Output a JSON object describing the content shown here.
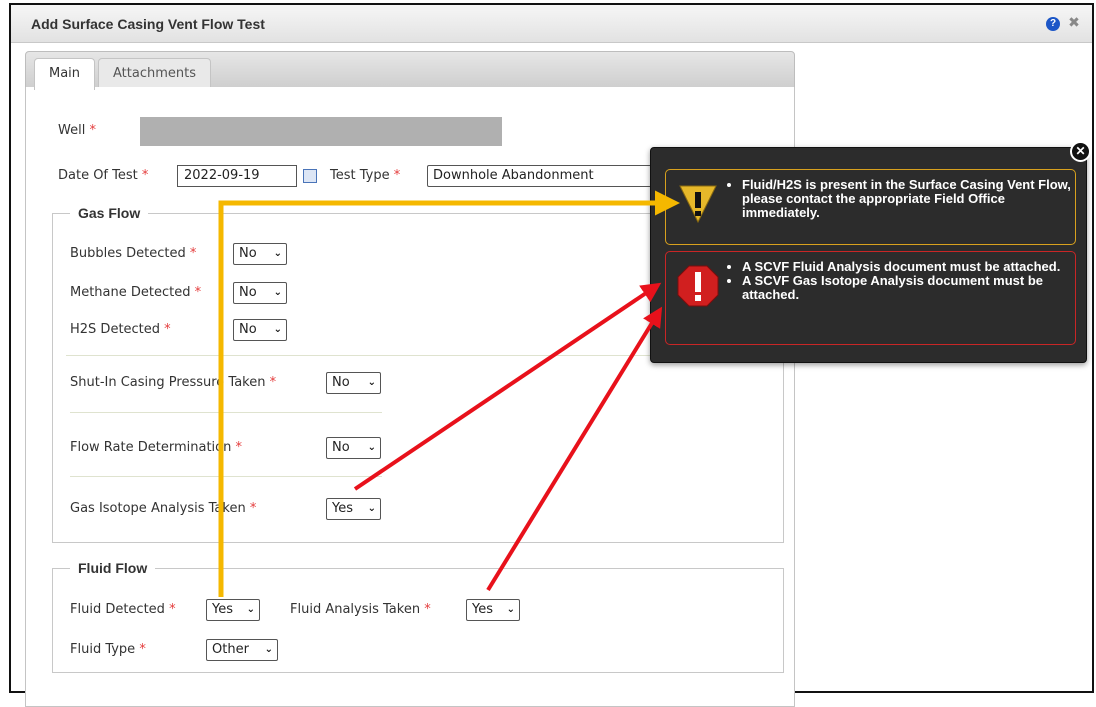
{
  "window": {
    "title": "Add Surface Casing Vent Flow Test",
    "help_icon": "question-circle-icon",
    "close_icon": "close-icon"
  },
  "tabs": [
    {
      "label": "Main",
      "active": true
    },
    {
      "label": "Attachments",
      "active": false
    }
  ],
  "form": {
    "well": {
      "label": "Well",
      "required_mark": "*"
    },
    "date_of_test": {
      "label": "Date Of Test",
      "value": "2022-09-19",
      "required_mark": "*"
    },
    "test_type": {
      "label": "Test Type",
      "value": "Downhole Abandonment",
      "required_mark": "*"
    },
    "gas_flow": {
      "legend": "Gas Flow",
      "bubbles_detected": {
        "label": "Bubbles Detected",
        "value": "No"
      },
      "methane_detected": {
        "label": "Methane Detected",
        "value": "No"
      },
      "h2s_detected": {
        "label": "H2S Detected",
        "value": "No"
      },
      "shut_in_casing_pressure": {
        "label": "Shut-In Casing Pressure Taken",
        "value": "No"
      },
      "flow_rate_determination": {
        "label": "Flow Rate Determination",
        "value": "No"
      },
      "gas_isotope_analysis": {
        "label": "Gas Isotope Analysis Taken",
        "value": "Yes"
      }
    },
    "fluid_flow": {
      "legend": "Fluid Flow",
      "fluid_detected": {
        "label": "Fluid Detected",
        "value": "Yes"
      },
      "fluid_analysis_taken": {
        "label": "Fluid Analysis Taken",
        "value": "Yes"
      },
      "fluid_type": {
        "label": "Fluid Type",
        "value": "Other"
      }
    },
    "required_mark": "*"
  },
  "validation_popup": {
    "close_icon": "close-circle-icon",
    "warning": {
      "icon": "warning-triangle-icon",
      "messages": [
        "Fluid/H2S is present in the Surface Casing Vent Flow, please contact the appropriate Field Office immediately."
      ]
    },
    "error": {
      "icon": "error-octagon-icon",
      "messages": [
        "A SCVF Fluid Analysis document must be attached.",
        "A SCVF Gas Isotope Analysis document must be attached."
      ]
    }
  },
  "colors": {
    "warning_arrow": "#f5b800",
    "error_arrow": "#e8111b",
    "required": "#e43b3b",
    "popup_bg": "#2c2c2c"
  }
}
